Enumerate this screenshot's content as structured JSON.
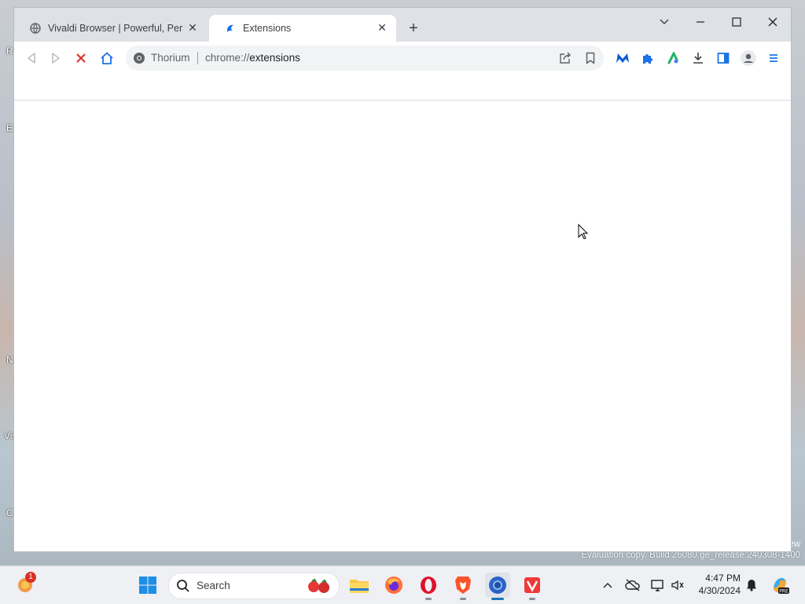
{
  "desktop": {
    "labels": [
      "R",
      "E",
      "N",
      "Vis",
      "C"
    ]
  },
  "browser": {
    "tabs": [
      {
        "title": "Vivaldi Browser | Powerful, Perso",
        "active": false
      },
      {
        "title": "Extensions",
        "active": true
      }
    ],
    "omnibox": {
      "site": "Thorium",
      "scheme": "chrome://",
      "host": "extensions"
    }
  },
  "watermark": {
    "line1": "ew",
    "line2": "Evaluation copy. Build 26080.ge_release.240308-1400"
  },
  "taskbar": {
    "search_label": "Search",
    "widgets_badge": "1",
    "clock_time": "4:47 PM",
    "clock_date": "4/30/2024"
  },
  "colors": {
    "accent": "#1a73e8",
    "stop_red": "#d93025"
  }
}
